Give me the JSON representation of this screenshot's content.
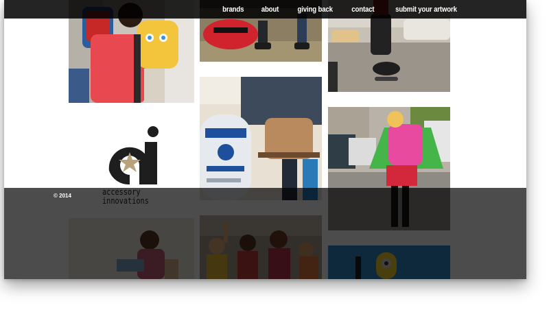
{
  "nav": {
    "items": [
      {
        "label": "brands"
      },
      {
        "label": "about"
      },
      {
        "label": "giving back"
      },
      {
        "label": "contact"
      },
      {
        "label": "submit your artwork"
      }
    ]
  },
  "logo": {
    "mark": "ai",
    "text_line1": "accessory",
    "text_line2": "innovations"
  },
  "footer": {
    "copyright": "© 2014"
  },
  "colors": {
    "topbar": "#000000",
    "logo_dark": "#1e1e1e",
    "logo_star": "#b8a37a",
    "overlay": "#000000"
  }
}
